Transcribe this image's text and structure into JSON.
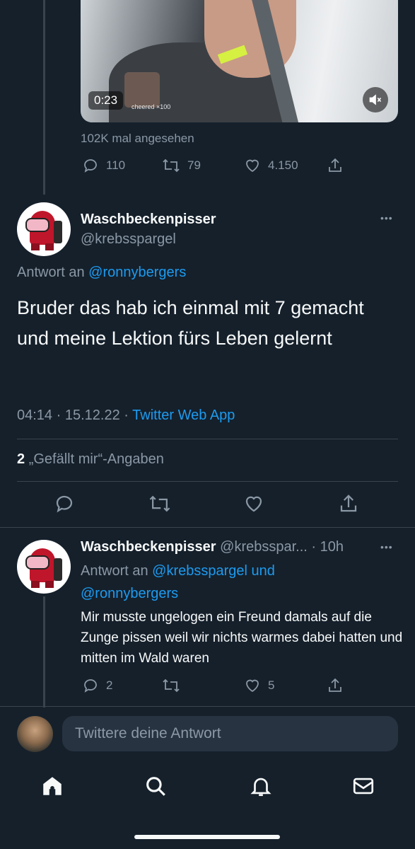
{
  "video": {
    "duration": "0:23",
    "overlay_text": "cheered ×100",
    "views": "102K mal angesehen",
    "stats": {
      "replies": "110",
      "retweets": "79",
      "likes": "4.150"
    }
  },
  "main_tweet": {
    "display_name": "Waschbeckenpisser",
    "handle": "@krebsspargel",
    "reply_prefix": "Antwort an ",
    "reply_to": "@ronnybergers",
    "text": "Bruder das hab ich einmal mit 7 gemacht und meine Lektion fürs Leben gelernt",
    "time": "04:14",
    "separator": "·",
    "date": "15.12.22",
    "source": "Twitter Web App",
    "likes_count": "2",
    "likes_label": "„Gefällt mir“-Angaben",
    "more": "•••"
  },
  "reply_tweet": {
    "display_name": "Waschbeckenpisser",
    "handle_time": "@krebsspar... · 10h",
    "reply_prefix": "Antwort an ",
    "reply_to_line1": "@krebsspargel und",
    "reply_to_line2": "@ronnybergers",
    "text": "Mir musste ungelogen ein Freund damals auf die Zunge pissen weil wir nichts warmes dabei hatten und mitten im Wald waren",
    "stats": {
      "replies": "2",
      "likes": "5"
    },
    "more": "•••"
  },
  "composer": {
    "placeholder": "Twittere deine Antwort"
  },
  "tabbar": [
    "home-icon",
    "search-icon",
    "notifications-icon",
    "messages-icon"
  ],
  "colors": {
    "background": "#15202b",
    "accent": "#1d9bf0",
    "muted": "#8b98a5"
  }
}
